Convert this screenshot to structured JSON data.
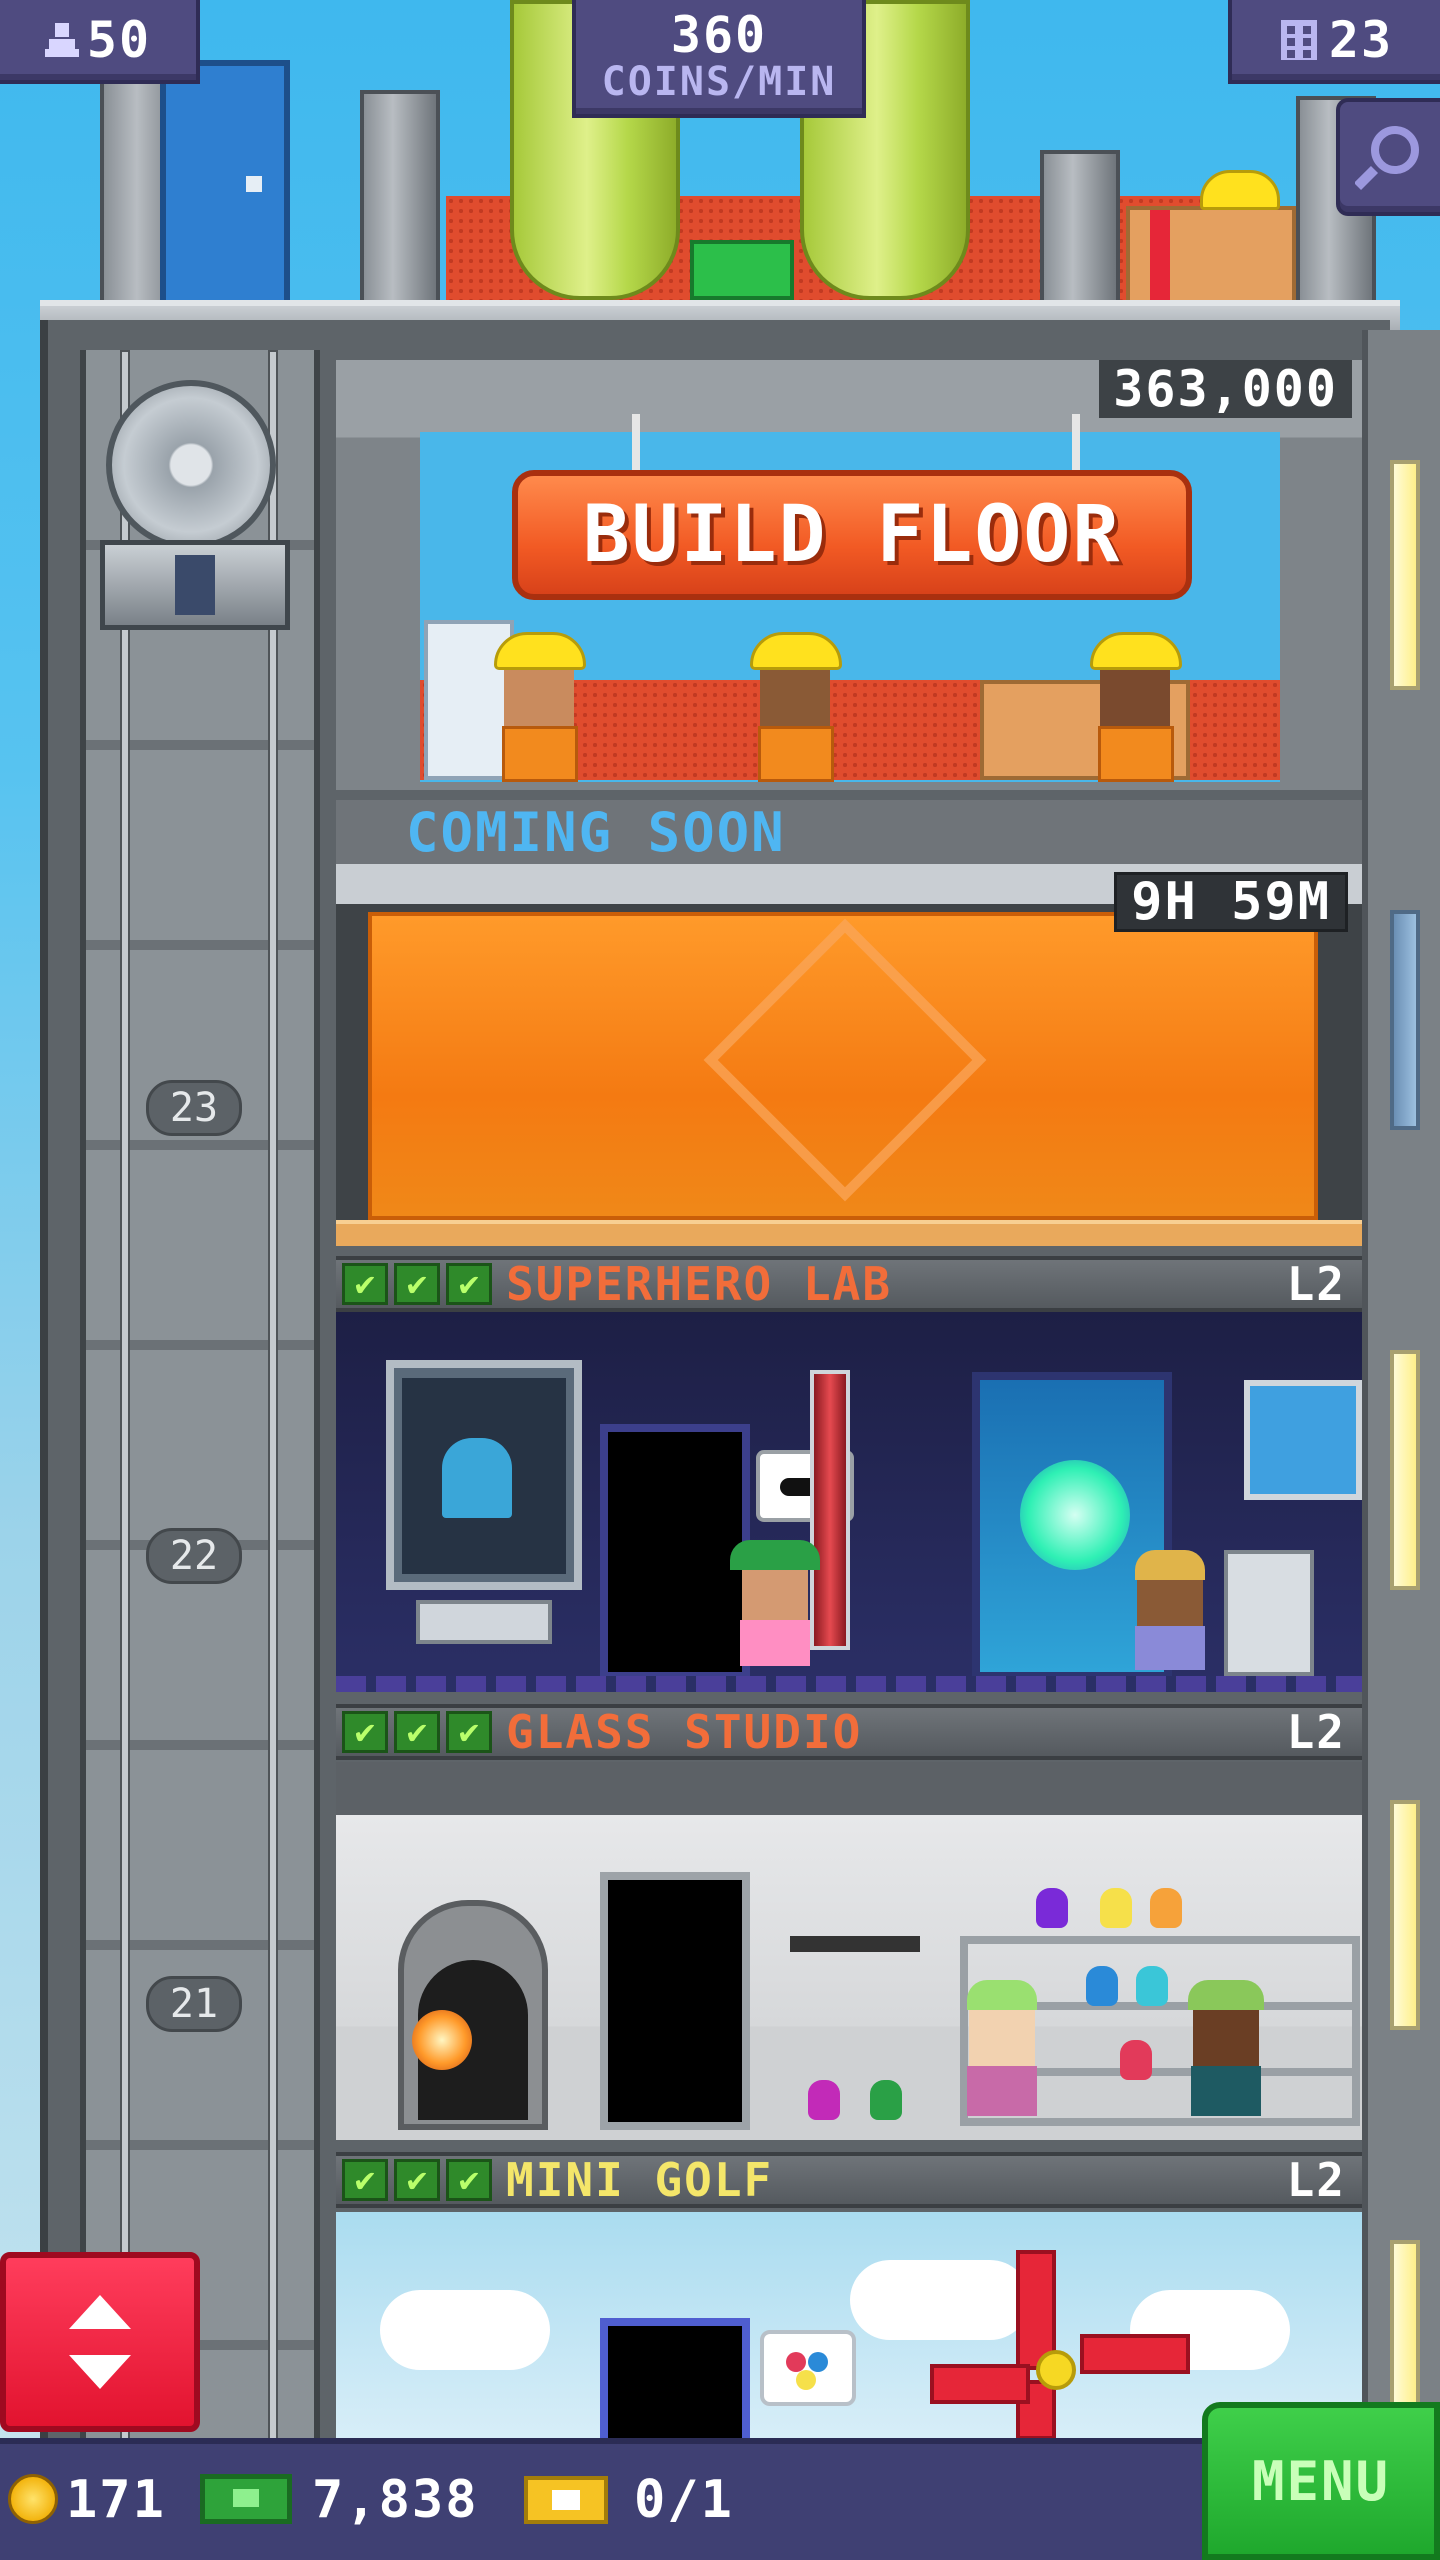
{
  "hud": {
    "residents_value": "50",
    "coins_per_min_value": "360",
    "coins_per_min_label": "COINS/MIN",
    "floors_value": "23"
  },
  "build_floor": {
    "price": "363,000",
    "button_label": "BUILD FLOOR"
  },
  "coming_soon": {
    "title": "COMING SOON",
    "timer": "9H 59M"
  },
  "floors": [
    {
      "number": "23",
      "name": "SUPERHERO LAB",
      "level": "L2",
      "name_color": "#f26d3a"
    },
    {
      "number": "22",
      "name": "GLASS STUDIO",
      "level": "L2",
      "name_color": "#f26d3a"
    },
    {
      "number": "21",
      "name": "MINI GOLF",
      "level": "L2",
      "name_color": "#f4e66a"
    }
  ],
  "elevator_labels": {
    "f23": "23",
    "f22": "22",
    "f21": "21"
  },
  "bottom_bar": {
    "coins": "171",
    "bux": "7,838",
    "tickets": "0/1",
    "menu_label": "MENU"
  },
  "icons": {
    "residents": "person-icon",
    "floors": "building-icon",
    "search": "magnifier-icon",
    "elevator": "up-down-arrows-icon",
    "coin": "coin-icon",
    "bux": "cash-icon",
    "ticket": "vip-ticket-icon",
    "check": "check-icon"
  },
  "colors": {
    "hud_bg": "#4f4b80",
    "build_button": "#f25a24",
    "coming_soon_text": "#4fb6f2",
    "menu_button": "#1fa82d",
    "elevator_button": "#e2132f"
  }
}
